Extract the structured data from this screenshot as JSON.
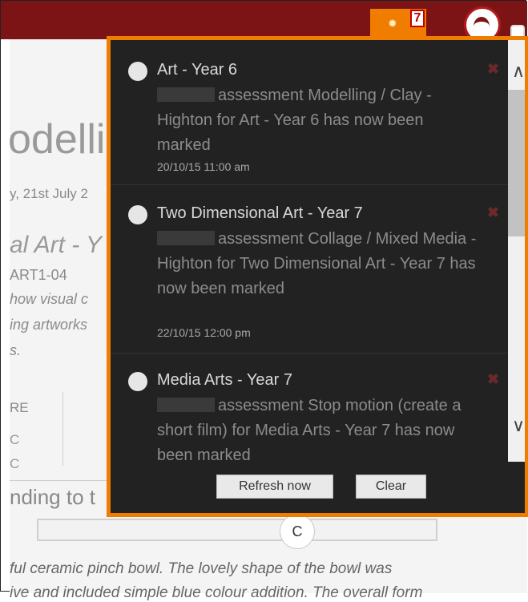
{
  "topbar": {
    "notification_count": "7",
    "bell_icon": "bell-icon",
    "logo_icon": "school-logo-icon"
  },
  "background_page": {
    "title_fragment": "odelli",
    "date_fragment": "y, 21st July 2",
    "subject_fragment": "al Art - Y",
    "code_fragment": "ART1-04",
    "text_lines": [
      "how visual c",
      "ing artworks",
      "s."
    ],
    "score_label": "RE",
    "tick_marks": [
      "C",
      "C"
    ],
    "responding_fragment": "nding to t",
    "slider_knob_label": "C",
    "comment_lines": [
      "ful ceramic pinch bowl. The lovely shape of the bowl was",
      "ive and included simple blue colour addition. The overall form"
    ]
  },
  "notifications": [
    {
      "title": "Art - Year 6",
      "body": "assessment Modelling / Clay - Highton for Art - Year 6 has now been marked",
      "time": "20/10/15 11:00 am"
    },
    {
      "title": "Two Dimensional Art - Year 7",
      "body": "assessment Collage / Mixed Media - Highton for Two Dimensional Art - Year 7 has now been marked",
      "time": "22/10/15 12:00 pm"
    },
    {
      "title": "Media Arts - Year 7",
      "body": "assessment Stop motion (create a short film) for Media Arts - Year 7 has now been marked",
      "time": ""
    }
  ],
  "panel": {
    "refresh_label": "Refresh now",
    "clear_label": "Clear",
    "scroll_up_icon": "chevron-up-icon",
    "scroll_down_icon": "chevron-down-icon",
    "dismiss_icon": "close-icon"
  },
  "colors": {
    "topbar": "#7c1416",
    "accent_orange": "#f07c00",
    "panel_bg": "#222222"
  }
}
